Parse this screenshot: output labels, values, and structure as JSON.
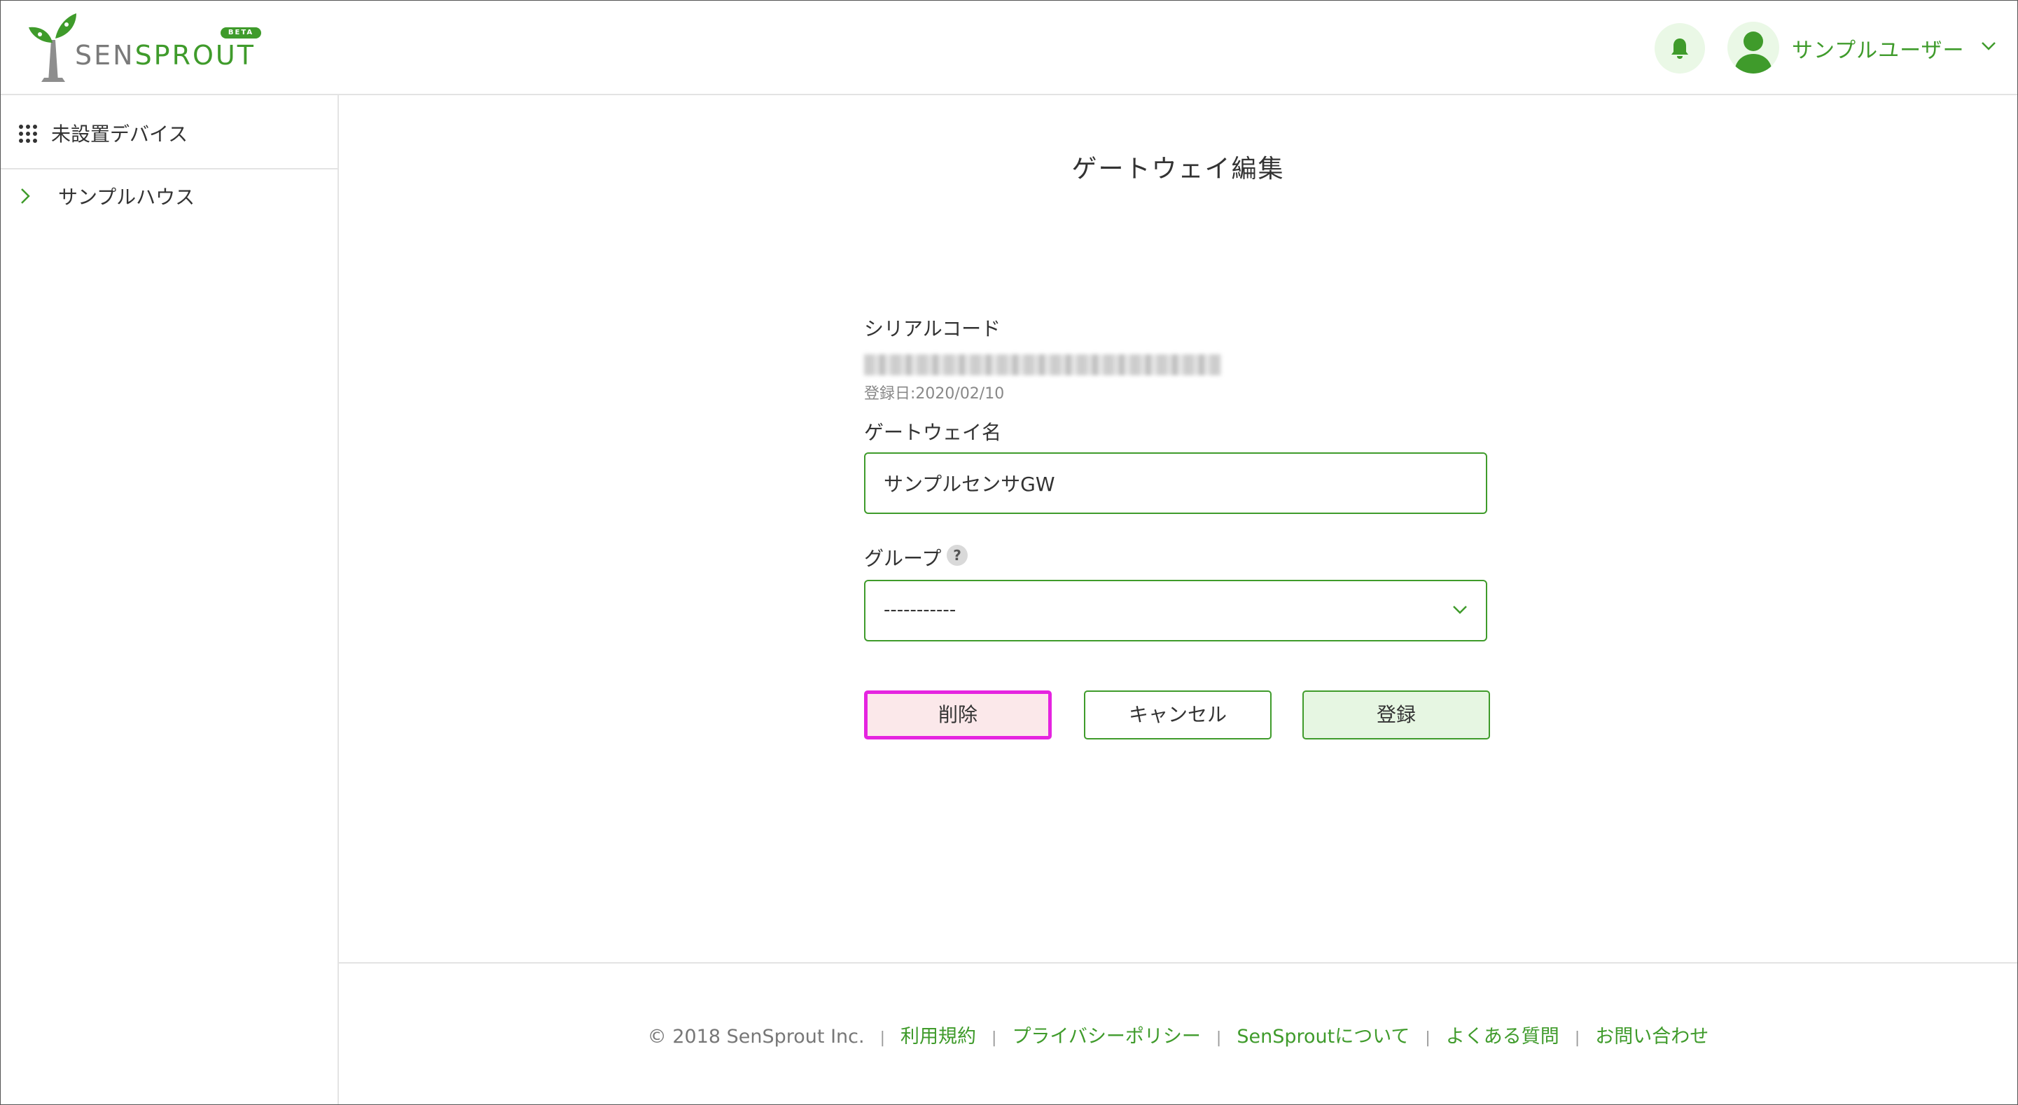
{
  "header": {
    "logo": {
      "text_sen": "SEN",
      "text_sprout": "SPROUT",
      "badge": "BETA"
    },
    "notifications_icon": "bell-icon",
    "user_icon": "user-avatar-icon",
    "user_name": "サンプルユーザー"
  },
  "sidebar": {
    "unplaced_devices": {
      "icon": "grid-icon",
      "label": "未設置デバイス"
    },
    "groups": [
      {
        "icon": "chevron-right-icon",
        "label": "サンプルハウス"
      }
    ]
  },
  "main": {
    "title": "ゲートウェイ編集",
    "serial": {
      "label": "シリアルコード",
      "registered_date": "登録日:2020/02/10"
    },
    "gateway_name": {
      "label": "ゲートウェイ名",
      "value": "サンプルセンサGW"
    },
    "group": {
      "label": "グループ",
      "help_icon": "?",
      "selected": "-----------"
    },
    "buttons": {
      "delete": "削除",
      "cancel": "キャンセル",
      "register": "登録"
    }
  },
  "footer": {
    "copyright": "© 2018 SenSprout Inc.",
    "separator": "|",
    "links": [
      "利用規約",
      "プライバシーポリシー",
      "SenSproutについて",
      "よくある質問",
      "お問い合わせ"
    ]
  },
  "colors": {
    "brand_green": "#3f9b2b",
    "light_green": "#eaf8e6",
    "delete_bg": "#fbe8ea",
    "highlight_magenta": "#e524e0"
  }
}
